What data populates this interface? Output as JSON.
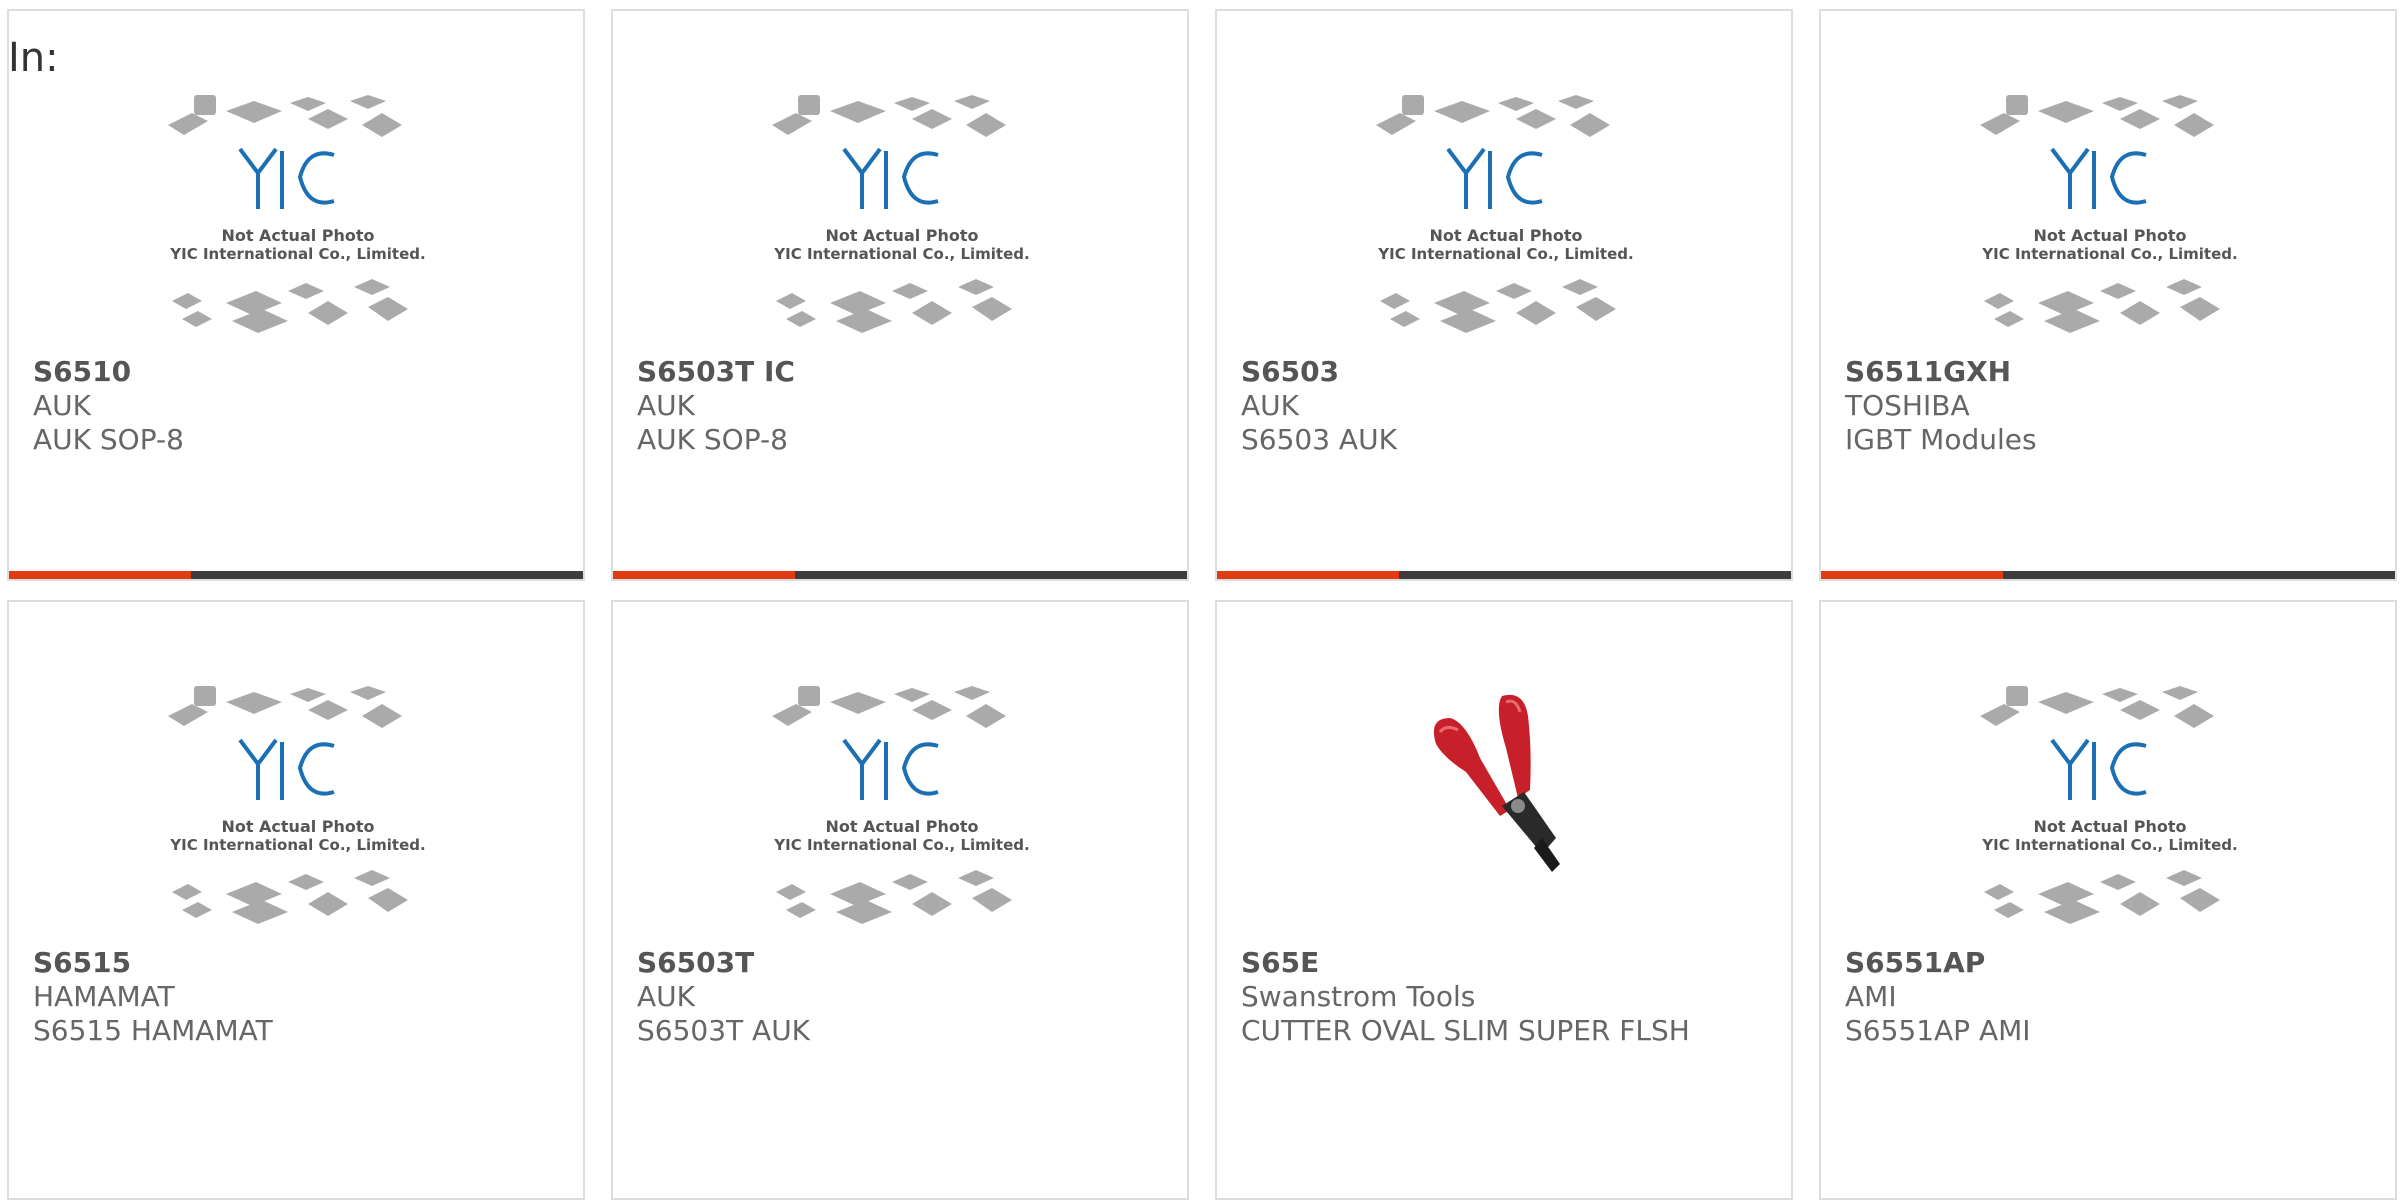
{
  "page": {
    "in_label": "In:"
  },
  "placeholder": {
    "line1": "Not Actual Photo",
    "line2": "YIC International Co., Limited.",
    "logo": "YIC"
  },
  "colors": {
    "accent": "#e23a12",
    "bar": "#3d3d3d",
    "logo_blue": "#1a6fb5",
    "tool_red": "#c8202a"
  },
  "cards": [
    {
      "part": "S6510",
      "maker": "AUK",
      "desc": "AUK SOP-8",
      "image": "yic-placeholder-icon"
    },
    {
      "part": "S6503T IC",
      "maker": "AUK",
      "desc": "AUK SOP-8",
      "image": "yic-placeholder-icon"
    },
    {
      "part": "S6503",
      "maker": "AUK",
      "desc": "S6503 AUK",
      "image": "yic-placeholder-icon"
    },
    {
      "part": "S6511GXH",
      "maker": "TOSHIBA",
      "desc": "IGBT Modules",
      "image": "yic-placeholder-icon"
    },
    {
      "part": "S6515",
      "maker": "HAMAMAT",
      "desc": "S6515 HAMAMAT",
      "image": "yic-placeholder-icon"
    },
    {
      "part": "S6503T",
      "maker": "AUK",
      "desc": "S6503T AUK",
      "image": "yic-placeholder-icon"
    },
    {
      "part": "S65E",
      "maker": "Swanstrom Tools",
      "desc": "CUTTER OVAL SLIM SUPER FLSH",
      "image": "cutter-icon"
    },
    {
      "part": "S6551AP",
      "maker": "AMI",
      "desc": "S6551AP AMI",
      "image": "yic-placeholder-icon"
    }
  ]
}
